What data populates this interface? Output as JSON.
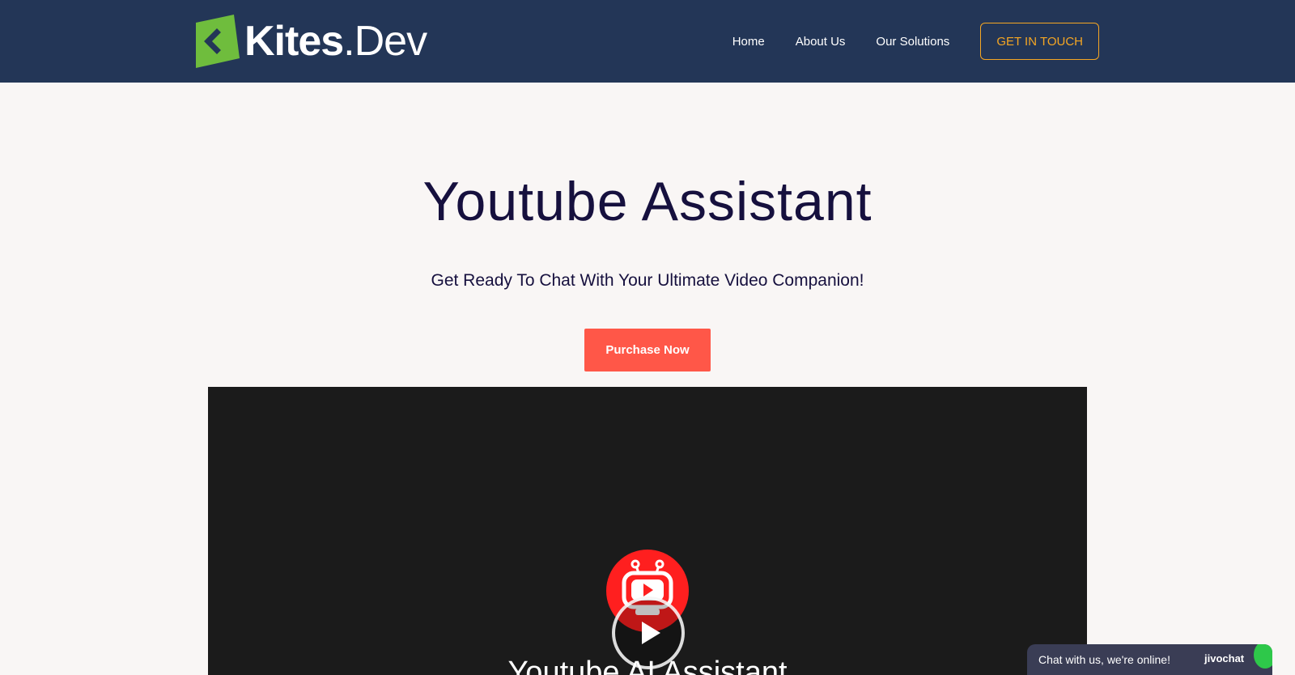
{
  "header": {
    "logo": {
      "name": "Kites",
      "suffix": ".Dev",
      "mark_color": "#6fbd3d"
    },
    "nav": [
      {
        "label": "Home"
      },
      {
        "label": "About Us"
      },
      {
        "label": "Our Solutions"
      }
    ],
    "cta_label": "GET IN TOUCH",
    "background": "#233657",
    "cta_color": "#f5a623"
  },
  "hero": {
    "title": "Youtube Assistant",
    "subtitle": "Get Ready To Chat With Your Ultimate Video Companion!",
    "button_label": "Purchase Now",
    "button_color": "#ff5748",
    "text_color": "#16103e"
  },
  "video": {
    "caption": "Youtube AI Assistant",
    "logo_icon": "youtube-robot-icon",
    "play_icon": "play-icon",
    "background": "#1b1b1b"
  },
  "chat_widget": {
    "message": "Chat with us, we're online!",
    "brand": "jivochat"
  }
}
